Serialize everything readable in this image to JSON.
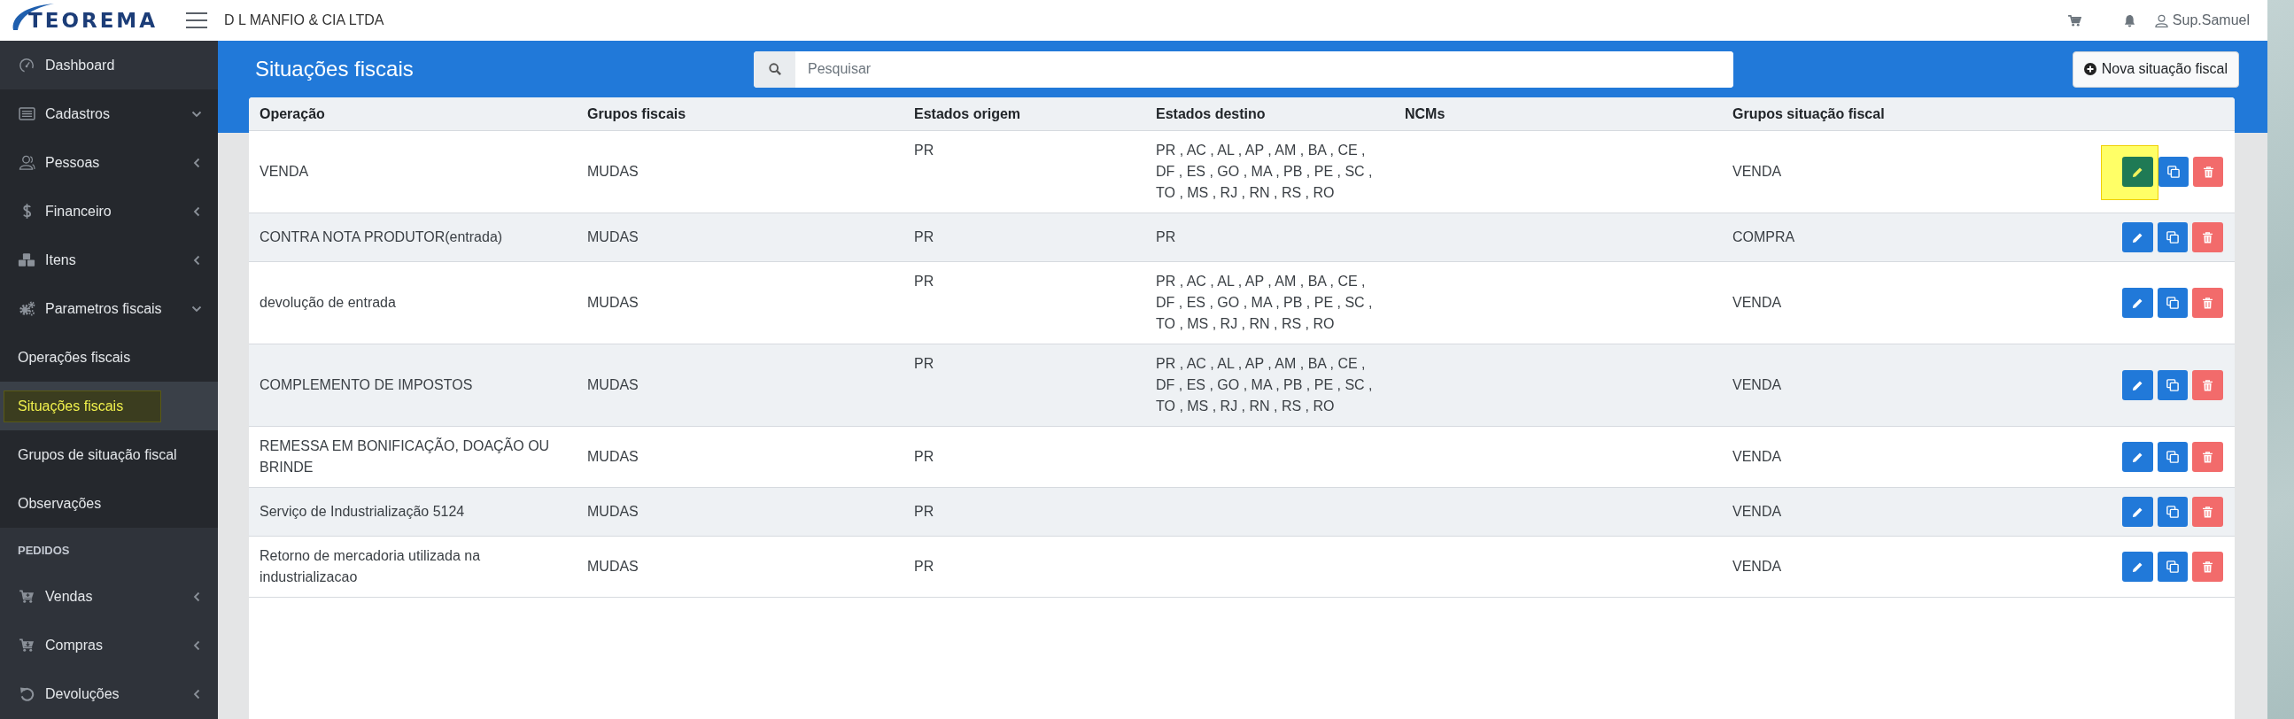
{
  "header": {
    "logo": "TEOREMA",
    "company": "D L MANFIO & CIA LTDA",
    "user": "Sup.Samuel"
  },
  "sidebar": {
    "sections": [
      {
        "items": [
          {
            "label": "Dashboard"
          },
          {
            "label": "Cadastros",
            "expanded": true
          },
          {
            "label": "Pessoas",
            "expanded": false
          },
          {
            "label": "Financeiro",
            "expanded": false
          },
          {
            "label": "Itens",
            "expanded": false
          },
          {
            "label": "Parametros fiscais",
            "expanded": true,
            "children": [
              {
                "label": "Operações fiscais",
                "selected": false,
                "highlighted": false
              },
              {
                "label": "Situações fiscais",
                "selected": true,
                "highlighted": true
              },
              {
                "label": "Grupos de situação fiscal",
                "selected": false,
                "highlighted": false
              },
              {
                "label": "Observações",
                "selected": false,
                "highlighted": false
              }
            ]
          }
        ]
      },
      {
        "heading": "PEDIDOS",
        "items": [
          {
            "label": "Vendas",
            "expanded": false
          },
          {
            "label": "Compras",
            "expanded": false
          },
          {
            "label": "Devoluções",
            "expanded": false
          }
        ]
      }
    ]
  },
  "page": {
    "title": "Situações fiscais",
    "search": {
      "placeholder": "Pesquisar"
    },
    "new_button": "Nova situação fiscal"
  },
  "table": {
    "columns": [
      "Operação",
      "Grupos fiscais",
      "Estados origem",
      "Estados destino",
      "NCMs",
      "Grupos situação fiscal"
    ],
    "rows": [
      {
        "operation": "VENDA",
        "fiscal_groups": "MUDAS",
        "origin_states": "PR",
        "destination_states": "PR , AC , AL , AP , AM , BA , CE , DF , ES , GO , MA , PB , PE , SC , TO , MS , RJ , RN , RS , RO",
        "situation_group": "VENDA",
        "edit_highlighted": true
      },
      {
        "operation": "CONTRA NOTA PRODUTOR(entrada)",
        "fiscal_groups": "MUDAS",
        "origin_states": "PR",
        "destination_states": "PR",
        "situation_group": "COMPRA",
        "edit_highlighted": false
      },
      {
        "operation": "devolução de entrada",
        "fiscal_groups": "MUDAS",
        "origin_states": "PR",
        "destination_states": "PR , AC , AL , AP , AM , BA , CE , DF , ES , GO , MA , PB , PE , SC , TO , MS , RJ , RN , RS , RO",
        "situation_group": "VENDA",
        "edit_highlighted": false
      },
      {
        "operation": "COMPLEMENTO DE IMPOSTOS",
        "fiscal_groups": "MUDAS",
        "origin_states": "PR",
        "destination_states": "PR , AC , AL , AP , AM , BA , CE , DF , ES , GO , MA , PB , PE , SC , TO , MS , RJ , RN , RS , RO",
        "situation_group": "VENDA",
        "edit_highlighted": false
      },
      {
        "operation": "REMESSA EM BONIFICAÇÃO, DOAÇÃO OU BRINDE",
        "fiscal_groups": "MUDAS",
        "origin_states": "PR",
        "situation_group": "VENDA",
        "edit_highlighted": false
      },
      {
        "operation": "Serviço de Industrialização 5124",
        "fiscal_groups": "MUDAS",
        "origin_states": "PR",
        "situation_group": "VENDA",
        "edit_highlighted": false
      },
      {
        "operation": "Retorno de mercadoria utilizada na industrializacao",
        "fiscal_groups": "MUDAS",
        "origin_states": "PR",
        "situation_group": "VENDA",
        "edit_highlighted": false
      }
    ]
  }
}
